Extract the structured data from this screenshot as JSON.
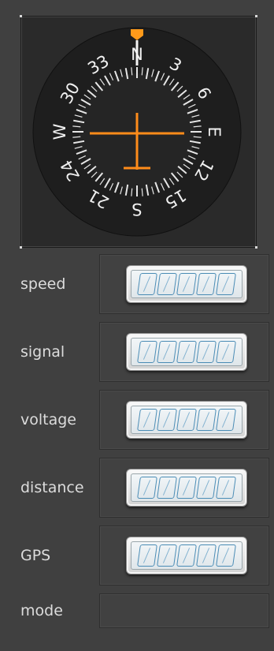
{
  "compass": {
    "cardinals": [
      "N",
      "E",
      "S",
      "W"
    ],
    "numbers": [
      "3",
      "6",
      "12",
      "15",
      "21",
      "24",
      "30",
      "33"
    ],
    "heading_marker_color": "#ff9a1a",
    "aircraft_color": "#ff8c1a",
    "dial_color": "#1e1e1e"
  },
  "readouts": [
    {
      "label": "speed",
      "value": "00000"
    },
    {
      "label": "signal",
      "value": "00000"
    },
    {
      "label": "voltage",
      "value": "00000"
    },
    {
      "label": "distance",
      "value": "00000"
    },
    {
      "label": "GPS",
      "value": "00000"
    }
  ],
  "mode": {
    "label": "mode",
    "value": ""
  },
  "colors": {
    "panel_bg": "#404040",
    "lcd_digit": "#4a8cb5",
    "label_text": "#dcdcdc"
  }
}
